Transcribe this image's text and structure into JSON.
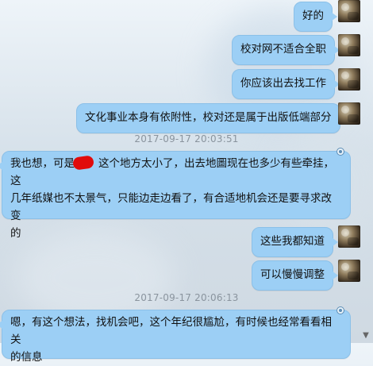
{
  "messages": [
    {
      "side": "right",
      "text": "好的"
    },
    {
      "side": "right",
      "text": "校对网不适合全职"
    },
    {
      "side": "right",
      "text": "你应该出去找工作"
    },
    {
      "side": "right",
      "text": "文化事业本身有依附性，校对还是属于出版低端部分"
    },
    {
      "timestamp": "2017-09-17 20:03:51"
    },
    {
      "side": "left",
      "line1": "我也想，可是",
      "line1_after": "这个地方太小了，出去地圖现在也多少有些牵挂，这",
      "line2": "几年纸媒也不太景气，只能边走边看了，有合适地机会还是要寻求改变",
      "line3": "的"
    },
    {
      "side": "right",
      "text": "这些我都知道"
    },
    {
      "side": "right",
      "text": "可以慢慢调整"
    },
    {
      "timestamp": "2017-09-17 20:06:13"
    },
    {
      "side": "left",
      "line1": "嗯，有这个想法，找机会吧，这个年纪很尴尬，有时候也经常看看相关",
      "line2": "的信息"
    }
  ],
  "ui": {
    "scroll_down_icon": "▼"
  }
}
